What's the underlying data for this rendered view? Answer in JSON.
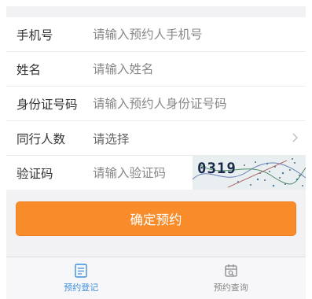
{
  "form": {
    "phone": {
      "label": "手机号",
      "placeholder": "请输入预约人手机号"
    },
    "name": {
      "label": "姓名",
      "placeholder": "请输入姓名"
    },
    "id_number": {
      "label": "身份证号码",
      "placeholder": "请输入预约人身份证号码"
    },
    "companions": {
      "label": "同行人数",
      "value": "请选择"
    },
    "captcha": {
      "label": "验证码",
      "placeholder": "请输入验证码",
      "image_text": "0319"
    }
  },
  "submit_label": "确定预约",
  "tabs": [
    {
      "label": "预约登记",
      "icon": "edit-list-icon",
      "active": true
    },
    {
      "label": "预约查询",
      "icon": "calendar-search-icon",
      "active": false
    }
  ],
  "colors": {
    "accent": "#f98c2a",
    "tab_active": "#3d8fdc",
    "tab_inactive": "#888888"
  }
}
